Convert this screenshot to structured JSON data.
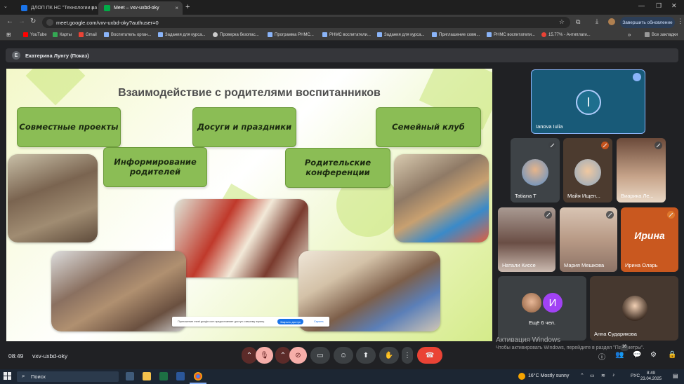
{
  "browser": {
    "tabs": [
      {
        "label": "ДЛОП ПК НС \"Технологии ра",
        "active": false
      },
      {
        "label": "Meet – vxv-uxbd-oky",
        "active": true
      }
    ],
    "url": "meet.google.com/vxv-uxbd-oky?authuser=0",
    "update_label": "Завершить обновление",
    "bookmarks": [
      "YouTube",
      "Карты",
      "Gmail",
      "Воспитатель орган...",
      "Задания для курса...",
      "Проверка безопас...",
      "Программа РНМС...",
      "РНМС воспитатели...",
      "Задания для курса...",
      "Приглашение совм...",
      "РНМС воспитатели...",
      "15.77% - Антиплаги..."
    ],
    "all_bookmarks": "Все закладки"
  },
  "meet": {
    "presenter": "Екатерина Лунгу (Показ)",
    "presenter_initial": "Е",
    "slide": {
      "title": "Взаимодействие с родителями воспитанников",
      "boxes": [
        "Совместные проекты",
        "Досуги и праздники",
        "Семейный клуб",
        "Информирование родителей",
        "Родительские конференции"
      ],
      "notice": "Приложение meet.google.com предоставляет доступ к вашему экрану.",
      "notice_button": "Закрыть доступ",
      "notice_link": "Скрыть"
    },
    "featured": {
      "name": "Ianova Iulia",
      "initial": "I"
    },
    "participants": [
      "Tatiana T",
      "Майя Ищен...",
      "Виарика Ле...",
      "Натали Киссе",
      "Мария Мешкова",
      "Ирина Оларь",
      "Ещё 6 чел.",
      "Анна Сударикова"
    ],
    "irina_logo": "Ирина",
    "more_initial": "И",
    "time": "08:49",
    "code": "vxv-uxbd-oky",
    "people_count": "16",
    "watermark_title": "Активация Windows",
    "watermark_sub": "Чтобы активировать Windows, перейдите в раздел \"Параметры\"."
  },
  "taskbar": {
    "search": "Поиск",
    "weather": "16°C  Mostly sunny",
    "lang": "РУС",
    "time": "8:49",
    "date": "23.04.2025"
  }
}
